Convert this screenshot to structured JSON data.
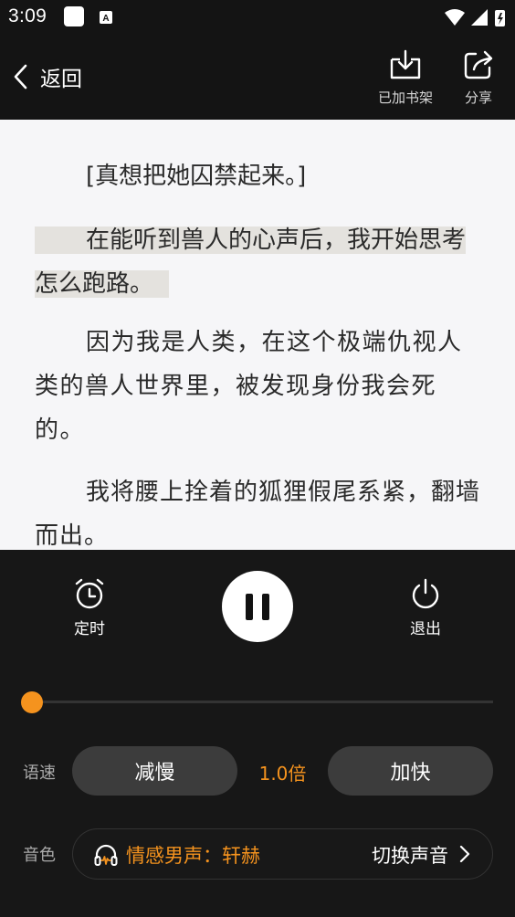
{
  "status": {
    "time": "3:09"
  },
  "nav": {
    "back_label": "返回",
    "add_shelf_label": "已加书架",
    "share_label": "分享"
  },
  "reader": {
    "p1": "[真想把她囚禁起来。]",
    "p2": "在能听到兽人的心声后，我开始思考怎么跑路。",
    "p3": "因为我是人类，在这个极端仇视人类的兽人世界里，被发现身份我会死的。",
    "p4": "我将腰上拴着的狐狸假尾系紧，翻墙而出。"
  },
  "player": {
    "timer_label": "定时",
    "exit_label": "退出",
    "progress_fraction": 0.0,
    "speed_label": "语速",
    "slower_label": "减慢",
    "speed_value": "1.0倍",
    "faster_label": "加快",
    "voice_label": "音色",
    "voice_name": "情感男声：轩赫",
    "switch_voice_label": "切换声音"
  },
  "colors": {
    "accent": "#f5931e",
    "highlight": "#e4e2de"
  },
  "icons": [
    "chevron-left-icon",
    "bookshelf-icon",
    "share-icon",
    "alarm-clock-icon",
    "pause-icon",
    "power-icon",
    "headphones-icon",
    "chevron-right-icon"
  ]
}
